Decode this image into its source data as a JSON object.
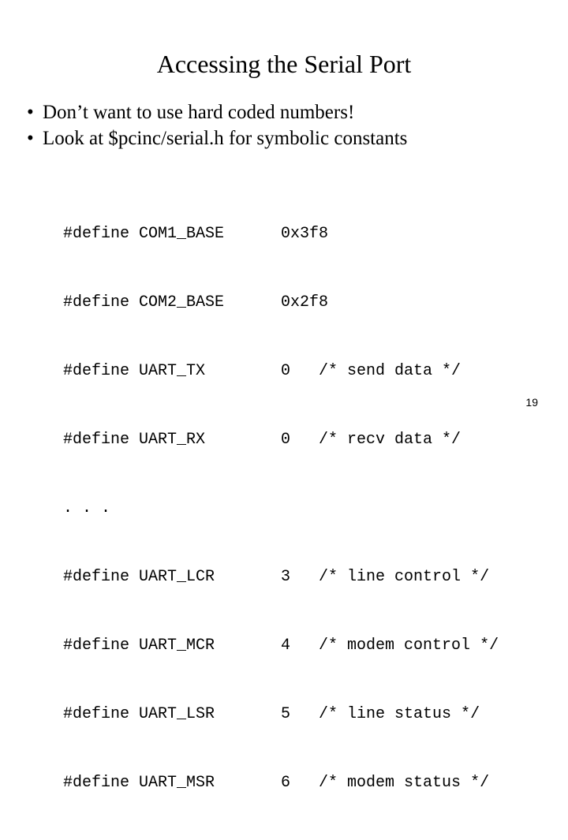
{
  "slide": {
    "title": "Accessing the Serial Port",
    "page_number": "19",
    "background_color": "#ffffff",
    "text_color": "#000000"
  },
  "bullets": [
    {
      "marker": "•",
      "text": "Don’t want to use hard coded numbers!"
    },
    {
      "marker": "•",
      "text": "Look at $pcinc/serial.h for symbolic constants"
    }
  ],
  "code": {
    "lines": [
      {
        "directive": "#define",
        "name": "COM1_BASE",
        "value": "0x3f8",
        "comment": ""
      },
      {
        "directive": "#define",
        "name": "COM2_BASE",
        "value": "0x2f8",
        "comment": ""
      },
      {
        "directive": "#define",
        "name": "UART_TX",
        "value": "0",
        "comment": "/* send data */"
      },
      {
        "directive": "#define",
        "name": "UART_RX",
        "value": "0",
        "comment": "/* recv data */"
      },
      {
        "directive": ". . .",
        "name": "",
        "value": "",
        "comment": ""
      },
      {
        "directive": "#define",
        "name": "UART_LCR",
        "value": "3",
        "comment": "/* line control */"
      },
      {
        "directive": "#define",
        "name": "UART_MCR",
        "value": "4",
        "comment": "/* modem control */"
      },
      {
        "directive": "#define",
        "name": "UART_LSR",
        "value": "5",
        "comment": "/* line status */"
      },
      {
        "directive": "#define",
        "name": "UART_MSR",
        "value": "6",
        "comment": "/* modem status */"
      }
    ]
  }
}
